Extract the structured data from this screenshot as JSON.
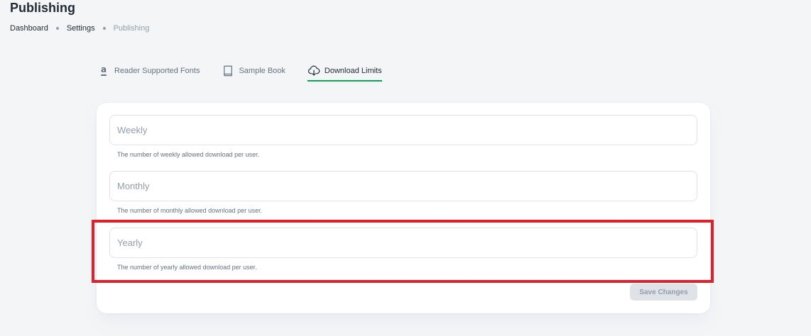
{
  "header": {
    "title": "Publishing",
    "breadcrumbs": [
      {
        "label": "Dashboard"
      },
      {
        "label": "Settings"
      },
      {
        "label": "Publishing"
      }
    ]
  },
  "tabs": [
    {
      "label": "Reader Supported Fonts",
      "icon": "amazon-icon",
      "active": false
    },
    {
      "label": "Sample Book",
      "icon": "book-icon",
      "active": false
    },
    {
      "label": "Download Limits",
      "icon": "cloud-download-icon",
      "active": true
    }
  ],
  "form": {
    "fields": [
      {
        "placeholder": "Weekly",
        "value": "",
        "helper": "The number of weekly allowed download per user."
      },
      {
        "placeholder": "Monthly",
        "value": "",
        "helper": "The number of monthly allowed download per user."
      },
      {
        "placeholder": "Yearly",
        "value": "",
        "helper": "The number of yearly allowed download per user."
      }
    ],
    "save_label": "Save Changes"
  },
  "colors": {
    "accent": "#00ab55",
    "highlight": "#e0202a",
    "background": "#f4f5f7",
    "disabled_button": "#dfe3e8"
  }
}
